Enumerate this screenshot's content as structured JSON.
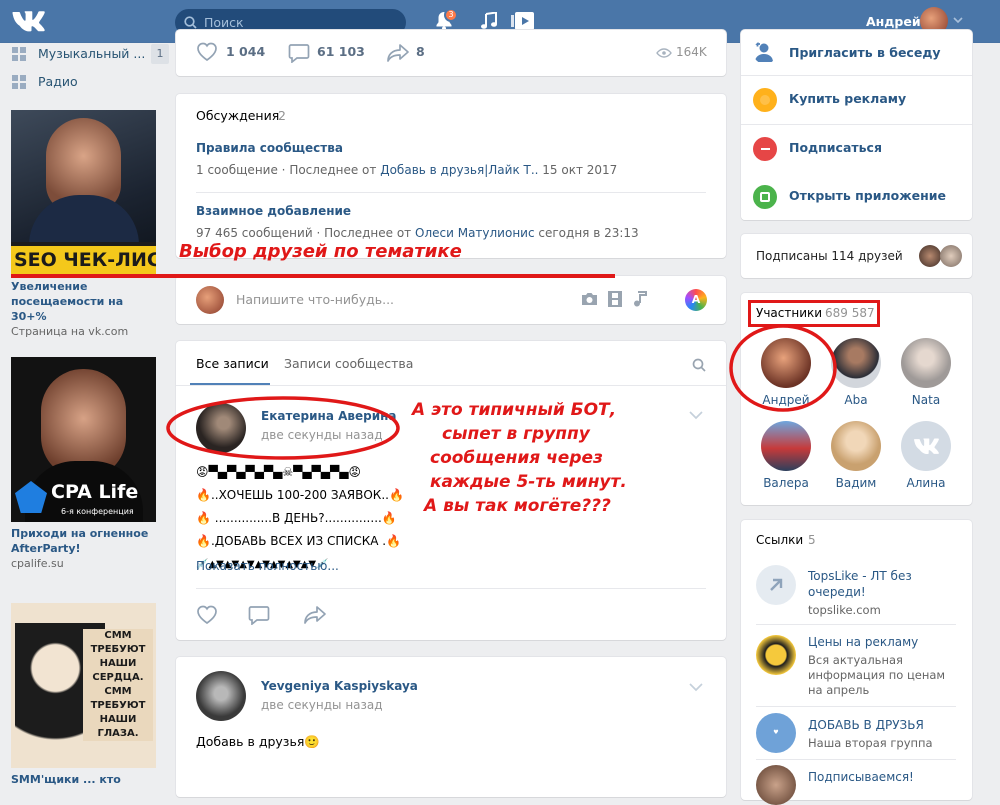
{
  "topbar": {
    "search_placeholder": "Поиск",
    "notification_count": "3",
    "user_name": "Андрей"
  },
  "left_nav": [
    {
      "icon": "music-icon",
      "label": "Музыкальный ...",
      "count": "1"
    },
    {
      "icon": "radio-icon",
      "label": "Радио",
      "count": ""
    }
  ],
  "ads": [
    {
      "banner": "SEO ЧЕК-ЛИСТ",
      "title": "Увеличение посещаемости на 30+%",
      "domain": "Страница на vk.com"
    },
    {
      "banner": "CPA Life",
      "banner_sub": "6-я конференция",
      "title": "Приходи на огненное AfterParty!",
      "domain": "cpalife.su"
    },
    {
      "banner": "СММ ТРЕБУЮТ НАШИ СЕРДЦА. СММ ТРЕБУЮТ НАШИ ГЛАЗА.",
      "title": "SMM'щики ... кто"
    }
  ],
  "post_stats": {
    "likes": "1 044",
    "comments": "61 103",
    "shares": "8",
    "views": "164K"
  },
  "discussions": {
    "title": "Обсуждения",
    "count": "2",
    "topics": [
      {
        "title": "Правила сообщества",
        "count": "1 сообщение",
        "last_prefix": "Последнее от",
        "last_author": "Добавь в друзья|Лайк Т..",
        "last_time": "15 окт 2017"
      },
      {
        "title": "Взаимное добавление",
        "count": "97 465 сообщений",
        "last_prefix": "Последнее от",
        "last_author": "Олеси Матулионис",
        "last_time": "сегодня в 23:13"
      }
    ]
  },
  "composer": {
    "placeholder": "Напишите что-нибудь..."
  },
  "tabs": {
    "all": "Все записи",
    "community": "Записи сообщества"
  },
  "posts": [
    {
      "author": "Екатерина Аверина",
      "time": "две секунды назад",
      "lines": [
        "😡▀▄▀▄▀▄▀▄☠▀▄▀▄▀▄😡",
        "🔥..ХОЧЕШЬ 100-200 ЗАЯВОК..🔥",
        "🔥 ...............В ДЕНЬ?...............🔥",
        "🔥.ДОБАВЬ ВСЕХ ИЗ СПИСКА .🔥",
        "💉▲▼▲▼▲▼▲▼▲▼▲▼▲▼💉"
      ],
      "show_more": "Показать полностью..."
    },
    {
      "author": "Yevgeniya Kaspiyskaya",
      "time": "две секунды назад",
      "text": "Добавь в друзья🙂"
    }
  ],
  "right_actions": [
    {
      "label": "Пригласить в беседу",
      "icon": "invite-icon",
      "color": "#5181b8"
    },
    {
      "label": "Купить рекламу",
      "icon": "ad-icon",
      "color": "#ffb11b"
    },
    {
      "label": "Подписаться",
      "icon": "subscribe-icon",
      "color": "#e64646"
    },
    {
      "label": "Открыть приложение",
      "icon": "app-icon",
      "color": "#4bb34b"
    }
  ],
  "friends_sub": {
    "label": "Подписаны 114 друзей"
  },
  "members": {
    "title": "Участники",
    "count": "689 587",
    "list": [
      {
        "name": "Андрей"
      },
      {
        "name": "Aba"
      },
      {
        "name": "Nata"
      },
      {
        "name": "Валера"
      },
      {
        "name": "Вадим"
      },
      {
        "name": "Алина"
      }
    ]
  },
  "links": {
    "title": "Ссылки",
    "count": "5",
    "items": [
      {
        "title": "TopsLike - ЛТ без очереди!",
        "sub": "topslike.com"
      },
      {
        "title": "Цены на рекламу",
        "sub": "Вся актуальная информация по ценам на апрель"
      },
      {
        "title": "ДОБАВЬ В ДРУЗЬЯ",
        "sub": "Наша вторая группа"
      },
      {
        "title": "Подписываемся!",
        "sub": ""
      }
    ]
  },
  "annotations": {
    "top": "Выбор друзей по тематике",
    "bot_lines": [
      "А это типичный БОТ,",
      "сыпет в группу",
      "сообщения через",
      "каждые 5-ть минут.",
      "А вы так могёте???"
    ]
  },
  "colors": {
    "topbar": "#4a76a8",
    "link": "#2a5885",
    "annotation": "#e01818",
    "background": "#edeef0"
  }
}
